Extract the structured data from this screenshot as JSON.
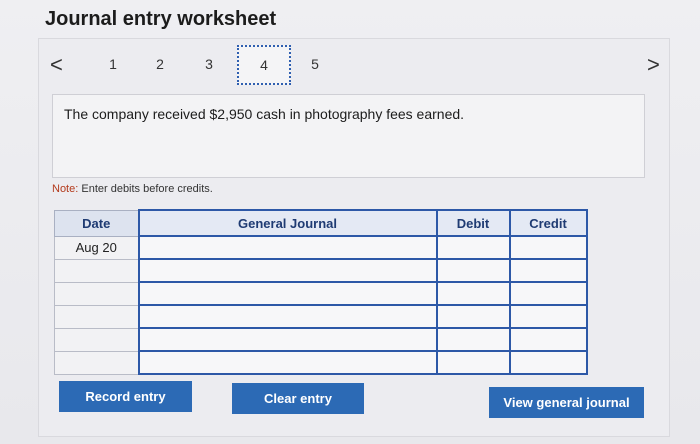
{
  "title": "Journal entry worksheet",
  "pager": {
    "prev_icon": "chevron-left-icon",
    "next_icon": "chevron-right-icon",
    "prev_glyph": "<",
    "next_glyph": ">",
    "pages": [
      "1",
      "2",
      "3",
      "4",
      "5"
    ],
    "active_page": "4"
  },
  "prompt": "The company received $2,950 cash in photography fees earned.",
  "note": {
    "label": "Note:",
    "text": "Enter debits before credits."
  },
  "table": {
    "headers": {
      "date": "Date",
      "general_journal": "General Journal",
      "debit": "Debit",
      "credit": "Credit"
    },
    "rows": [
      {
        "date": "Aug 20",
        "account": "",
        "debit": "",
        "credit": ""
      },
      {
        "date": "",
        "account": "",
        "debit": "",
        "credit": ""
      },
      {
        "date": "",
        "account": "",
        "debit": "",
        "credit": ""
      },
      {
        "date": "",
        "account": "",
        "debit": "",
        "credit": ""
      },
      {
        "date": "",
        "account": "",
        "debit": "",
        "credit": ""
      },
      {
        "date": "",
        "account": "",
        "debit": "",
        "credit": ""
      }
    ]
  },
  "buttons": {
    "record": "Record entry",
    "clear": "Clear entry",
    "view": "View general journal"
  },
  "colors": {
    "accent": "#2c6ab5",
    "note_label": "#b33a1c"
  }
}
